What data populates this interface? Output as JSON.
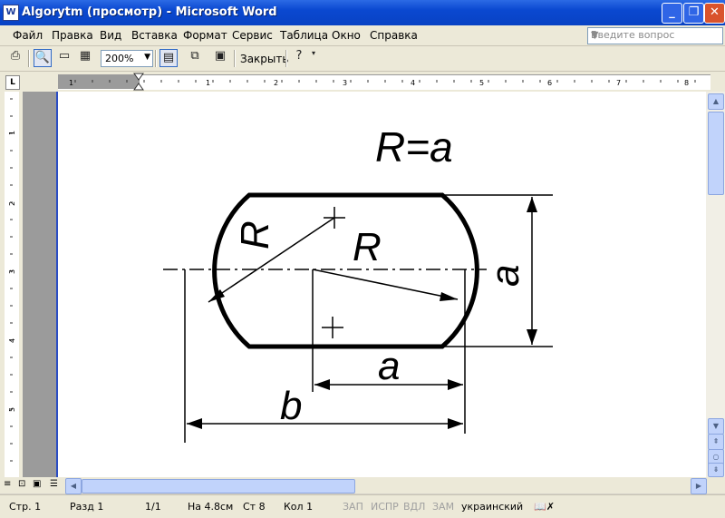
{
  "window": {
    "title": "Algorytm (просмотр) - Microsoft Word",
    "app_icon": "W",
    "controls": [
      "minimize-icon",
      "maximize-icon",
      "close-icon"
    ]
  },
  "menu": {
    "items": [
      "Файл",
      "Правка",
      "Вид",
      "Вставка",
      "Формат",
      "Сервис",
      "Таблица",
      "Окно",
      "Справка"
    ],
    "question_placeholder": "Введите вопрос"
  },
  "toolbar": {
    "zoom_value": "200%",
    "close_label": "Закрыть"
  },
  "ruler": {
    "h_numbers": [
      "1",
      "1",
      "2",
      "3",
      "4",
      "5",
      "6",
      "7",
      "8"
    ],
    "v_numbers": [
      "1",
      "2",
      "3",
      "4",
      "5"
    ],
    "corner": "L"
  },
  "drawing": {
    "formula": "R=a",
    "label_r_left": "R",
    "label_r_right": "R",
    "label_a_side": "a",
    "label_a_bottom": "a",
    "label_b": "b"
  },
  "status": {
    "page": "Стр. 1",
    "section": "Разд 1",
    "pages": "1/1",
    "at": "На 4.8см",
    "line": "Ст 8",
    "col": "Кол 1",
    "rec": "ЗАП",
    "trk": "ИСПР",
    "ext": "ВДЛ",
    "ovr": "ЗАМ",
    "language": "украинский"
  },
  "colors": {
    "titlebar": "#0a48d0",
    "chrome": "#ece9d8",
    "page_border": "#2a4dc4"
  }
}
